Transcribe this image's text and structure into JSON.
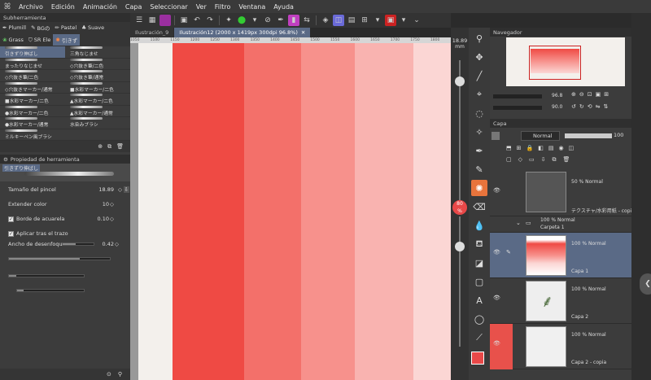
{
  "menu": {
    "items": [
      "Archivo",
      "Edición",
      "Animación",
      "Capa",
      "Seleccionar",
      "Ver",
      "Filtro",
      "Ventana",
      "Ayuda"
    ]
  },
  "subtool": {
    "header": "Subherramienta",
    "groups": [
      "Plumill",
      "BGの",
      "Pastel",
      "Suave",
      "Grass",
      "SR Ele",
      "引きず"
    ],
    "brushes": [
      [
        "引きずり伸ばし",
        "三角なじませ"
      ],
      [
        "まったりなじませ",
        "◇穴抜き筆/二色"
      ],
      [
        "◇穴抜き筆/二色",
        "◇穴抜き筆/通常"
      ],
      [
        "◇穴抜きマーカー/通常",
        "■水彩マーカー/二色"
      ],
      [
        "■水彩マーカー/二色",
        "▲水彩マーカー/二色"
      ],
      [
        "●水彩マーカー/二色",
        "▲水彩マーカー/通常"
      ],
      [
        "●水彩マーカー/通常",
        "水染みブラシ"
      ],
      [
        "ミルキーペン風ブラシ",
        ""
      ]
    ]
  },
  "toolprop": {
    "header": "Propiedad de herramienta",
    "selected": "引きずり伸ばし",
    "size_label": "Tamaño del pincel",
    "size_value": "18.89",
    "extend_label": "Extender color",
    "extend_value": "10",
    "edge_label": "Borde de acuarela",
    "edge_value": "0.10",
    "apply_label": "Aplicar tras el trazo",
    "blur_label": "Ancho de desenfoque",
    "blur_value": "0.42"
  },
  "tabs": {
    "tab1": "Ilustración_9",
    "tab2": "Ilustración12 (2000 x 1419px 300dpi 96.8%)"
  },
  "ruler": {
    "ticks": [
      "1050",
      "1100",
      "1150",
      "1200",
      "1250",
      "1300",
      "1350",
      "1400",
      "1450",
      "1500",
      "1550",
      "1600",
      "1650",
      "1700",
      "1750",
      "1800"
    ]
  },
  "side": {
    "size": "18.89",
    "unit": "mm",
    "opacity": "80",
    "pct": "%"
  },
  "navigator": {
    "header": "Navegador",
    "zoom": "96.8",
    "angle": "90.0"
  },
  "layers": {
    "header": "Capa",
    "blend": "Normal",
    "opacity": "100",
    "items": [
      {
        "mode": "50 % Normal",
        "name": "テクスチャ/水彩用紙 - copia"
      },
      {
        "mode": "100 % Normal",
        "name": "Carpeta 1"
      },
      {
        "mode": "100 % Normal",
        "name": "Capa 1"
      },
      {
        "mode": "100 % Normal",
        "name": "Capa 2"
      },
      {
        "mode": "100 % Normal",
        "name": "Capa 2 - copia"
      }
    ]
  },
  "colors": {
    "accent": "#e84848",
    "selected_layer": "#5a6a86",
    "paint_main": "#f04a44"
  }
}
